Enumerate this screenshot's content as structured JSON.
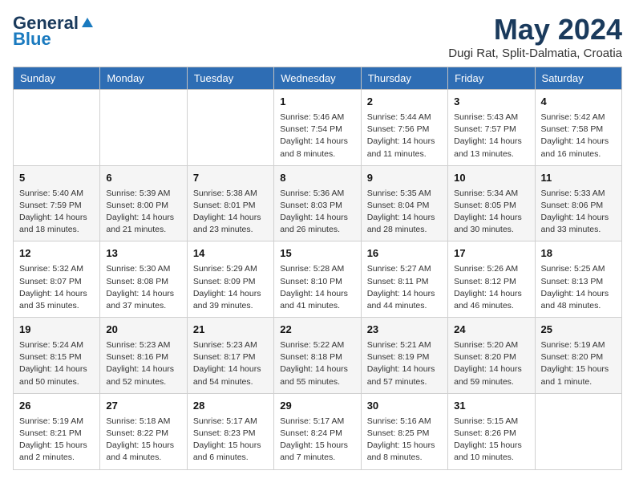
{
  "header": {
    "logo_general": "General",
    "logo_blue": "Blue",
    "month_title": "May 2024",
    "location": "Dugi Rat, Split-Dalmatia, Croatia"
  },
  "weekdays": [
    "Sunday",
    "Monday",
    "Tuesday",
    "Wednesday",
    "Thursday",
    "Friday",
    "Saturday"
  ],
  "weeks": [
    [
      {
        "day": "",
        "info": ""
      },
      {
        "day": "",
        "info": ""
      },
      {
        "day": "",
        "info": ""
      },
      {
        "day": "1",
        "info": "Sunrise: 5:46 AM\nSunset: 7:54 PM\nDaylight: 14 hours\nand 8 minutes."
      },
      {
        "day": "2",
        "info": "Sunrise: 5:44 AM\nSunset: 7:56 PM\nDaylight: 14 hours\nand 11 minutes."
      },
      {
        "day": "3",
        "info": "Sunrise: 5:43 AM\nSunset: 7:57 PM\nDaylight: 14 hours\nand 13 minutes."
      },
      {
        "day": "4",
        "info": "Sunrise: 5:42 AM\nSunset: 7:58 PM\nDaylight: 14 hours\nand 16 minutes."
      }
    ],
    [
      {
        "day": "5",
        "info": "Sunrise: 5:40 AM\nSunset: 7:59 PM\nDaylight: 14 hours\nand 18 minutes."
      },
      {
        "day": "6",
        "info": "Sunrise: 5:39 AM\nSunset: 8:00 PM\nDaylight: 14 hours\nand 21 minutes."
      },
      {
        "day": "7",
        "info": "Sunrise: 5:38 AM\nSunset: 8:01 PM\nDaylight: 14 hours\nand 23 minutes."
      },
      {
        "day": "8",
        "info": "Sunrise: 5:36 AM\nSunset: 8:03 PM\nDaylight: 14 hours\nand 26 minutes."
      },
      {
        "day": "9",
        "info": "Sunrise: 5:35 AM\nSunset: 8:04 PM\nDaylight: 14 hours\nand 28 minutes."
      },
      {
        "day": "10",
        "info": "Sunrise: 5:34 AM\nSunset: 8:05 PM\nDaylight: 14 hours\nand 30 minutes."
      },
      {
        "day": "11",
        "info": "Sunrise: 5:33 AM\nSunset: 8:06 PM\nDaylight: 14 hours\nand 33 minutes."
      }
    ],
    [
      {
        "day": "12",
        "info": "Sunrise: 5:32 AM\nSunset: 8:07 PM\nDaylight: 14 hours\nand 35 minutes."
      },
      {
        "day": "13",
        "info": "Sunrise: 5:30 AM\nSunset: 8:08 PM\nDaylight: 14 hours\nand 37 minutes."
      },
      {
        "day": "14",
        "info": "Sunrise: 5:29 AM\nSunset: 8:09 PM\nDaylight: 14 hours\nand 39 minutes."
      },
      {
        "day": "15",
        "info": "Sunrise: 5:28 AM\nSunset: 8:10 PM\nDaylight: 14 hours\nand 41 minutes."
      },
      {
        "day": "16",
        "info": "Sunrise: 5:27 AM\nSunset: 8:11 PM\nDaylight: 14 hours\nand 44 minutes."
      },
      {
        "day": "17",
        "info": "Sunrise: 5:26 AM\nSunset: 8:12 PM\nDaylight: 14 hours\nand 46 minutes."
      },
      {
        "day": "18",
        "info": "Sunrise: 5:25 AM\nSunset: 8:13 PM\nDaylight: 14 hours\nand 48 minutes."
      }
    ],
    [
      {
        "day": "19",
        "info": "Sunrise: 5:24 AM\nSunset: 8:15 PM\nDaylight: 14 hours\nand 50 minutes."
      },
      {
        "day": "20",
        "info": "Sunrise: 5:23 AM\nSunset: 8:16 PM\nDaylight: 14 hours\nand 52 minutes."
      },
      {
        "day": "21",
        "info": "Sunrise: 5:23 AM\nSunset: 8:17 PM\nDaylight: 14 hours\nand 54 minutes."
      },
      {
        "day": "22",
        "info": "Sunrise: 5:22 AM\nSunset: 8:18 PM\nDaylight: 14 hours\nand 55 minutes."
      },
      {
        "day": "23",
        "info": "Sunrise: 5:21 AM\nSunset: 8:19 PM\nDaylight: 14 hours\nand 57 minutes."
      },
      {
        "day": "24",
        "info": "Sunrise: 5:20 AM\nSunset: 8:20 PM\nDaylight: 14 hours\nand 59 minutes."
      },
      {
        "day": "25",
        "info": "Sunrise: 5:19 AM\nSunset: 8:20 PM\nDaylight: 15 hours\nand 1 minute."
      }
    ],
    [
      {
        "day": "26",
        "info": "Sunrise: 5:19 AM\nSunset: 8:21 PM\nDaylight: 15 hours\nand 2 minutes."
      },
      {
        "day": "27",
        "info": "Sunrise: 5:18 AM\nSunset: 8:22 PM\nDaylight: 15 hours\nand 4 minutes."
      },
      {
        "day": "28",
        "info": "Sunrise: 5:17 AM\nSunset: 8:23 PM\nDaylight: 15 hours\nand 6 minutes."
      },
      {
        "day": "29",
        "info": "Sunrise: 5:17 AM\nSunset: 8:24 PM\nDaylight: 15 hours\nand 7 minutes."
      },
      {
        "day": "30",
        "info": "Sunrise: 5:16 AM\nSunset: 8:25 PM\nDaylight: 15 hours\nand 8 minutes."
      },
      {
        "day": "31",
        "info": "Sunrise: 5:15 AM\nSunset: 8:26 PM\nDaylight: 15 hours\nand 10 minutes."
      },
      {
        "day": "",
        "info": ""
      }
    ]
  ]
}
